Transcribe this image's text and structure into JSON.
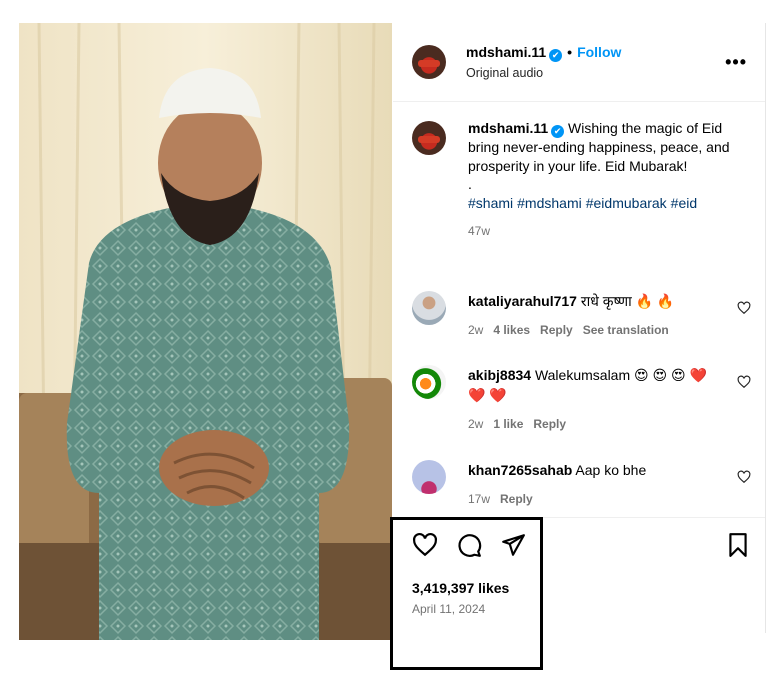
{
  "header": {
    "username": "mdshami.11",
    "verified": "✔",
    "separator": "•",
    "follow_label": "Follow",
    "audio": "Original audio",
    "more_label": "•••"
  },
  "caption": {
    "username": "mdshami.11",
    "text": "Wishing the magic of Eid bring never-ending happiness, peace, and prosperity in your life. Eid Mubarak!",
    "dot": ".",
    "hashtags": [
      "#shami",
      "#mdshami",
      "#eidmubarak",
      "#eid"
    ],
    "age": "47w"
  },
  "comments": [
    {
      "username": "kataliyarahul717",
      "text": "राधे कृष्णा 🔥 🔥",
      "age": "2w",
      "likes": "4 likes",
      "reply": "Reply",
      "translate": "See translation"
    },
    {
      "username": "akibj8834",
      "text": "Walekumsalam 😍 😍 😍 ❤️ ❤️ ❤️",
      "age": "2w",
      "likes": "1 like",
      "reply": "Reply"
    },
    {
      "username": "khan7265sahab",
      "text": "Aap ko bhe",
      "age": "17w",
      "reply": "Reply"
    }
  ],
  "footer": {
    "likes": "3,419,397 likes",
    "date": "April 11, 2024"
  },
  "icons": [
    "heart-icon",
    "comment-icon",
    "share-icon",
    "bookmark-icon",
    "verified-icon",
    "more-icon"
  ],
  "colors": {
    "accent": "#0095f6",
    "hashtag": "#00376b",
    "muted": "#737373"
  }
}
